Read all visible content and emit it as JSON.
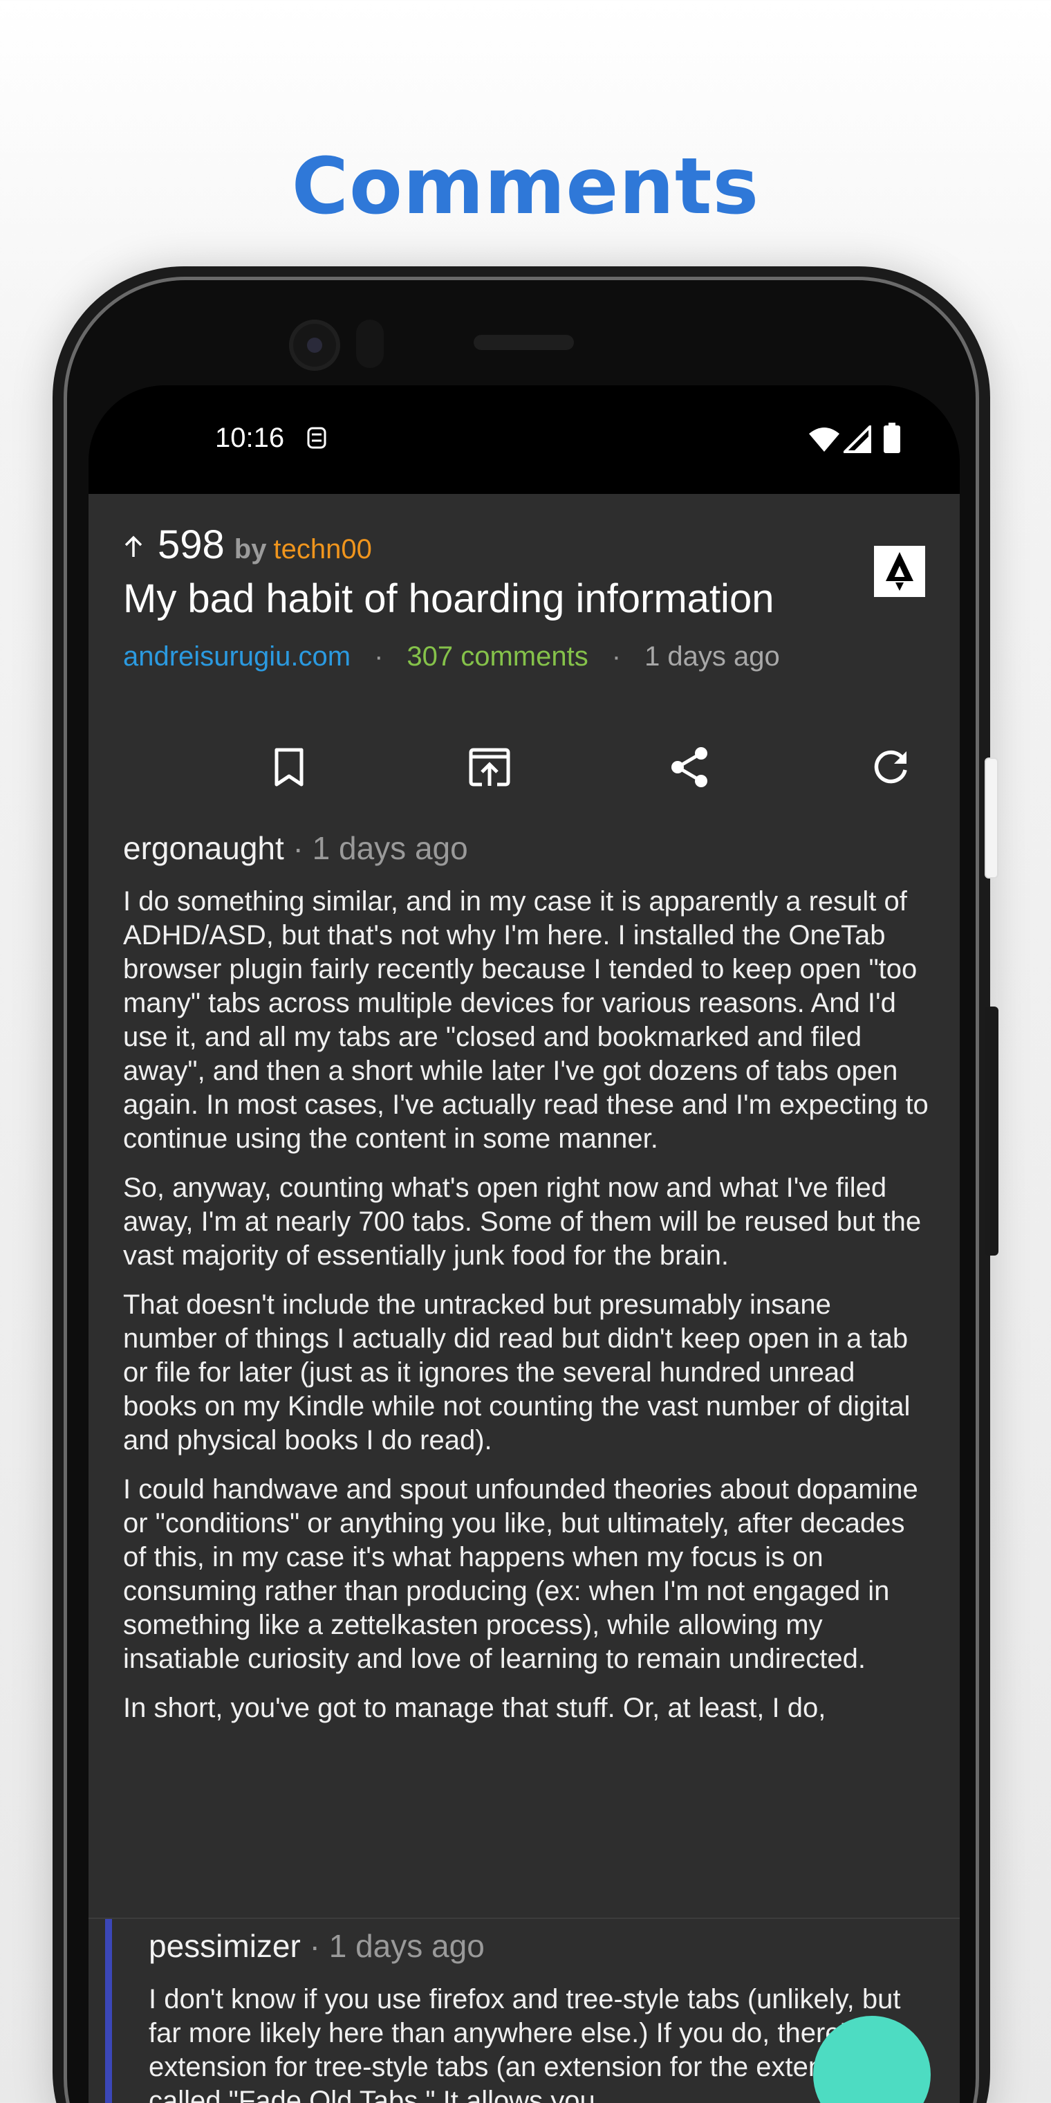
{
  "headline": "Comments",
  "status_bar": {
    "time": "10:16"
  },
  "post": {
    "score": "598",
    "by_label": "by",
    "author": "techn00",
    "title": "My bad habit of hoarding information",
    "domain": "andreisurugiu.com",
    "comments_count": "307 comments",
    "age": "1 days ago",
    "dot": "·"
  },
  "toolbar": {
    "icons": [
      "bookmark-icon",
      "open-external-icon",
      "share-icon",
      "refresh-icon"
    ]
  },
  "comments": [
    {
      "user": "ergonaught",
      "sep": "·",
      "age": "1 days ago",
      "paragraphs": [
        "I do something similar, and in my case it is apparently a result of ADHD/ASD, but that's not why I'm here. I installed the OneTab browser plugin fairly recently because I tended to keep open \"too many\" tabs across multiple devices for various reasons. And I'd use it, and all my tabs are \"closed and bookmarked and filed away\", and then a short while later I've got dozens of tabs open again. In most cases, I've actually read these and I'm expecting to continue using the content in some manner.",
        "So, anyway, counting what's open right now and what I've filed away, I'm at nearly 700 tabs. Some of them will be reused but the vast majority of essentially junk food for the brain.",
        "That doesn't include the untracked but presumably insane number of things I actually did read but didn't keep open in a tab or file for later (just as it ignores the several hundred unread books on my Kindle while not counting the vast number of digital and physical books I do read).",
        "I could handwave and spout unfounded theories about dopamine or \"conditions\" or anything you like, but ultimately, after decades of this, in my case it's what happens when my focus is on consuming rather than producing (ex: when I'm not engaged in something like a zettelkasten process), while allowing my insatiable curiosity and love of learning to remain undirected.",
        "In short, you've got to manage that stuff. Or, at least, I do,"
      ]
    },
    {
      "user": "pessimizer",
      "sep": "·",
      "age": "1 days ago",
      "paragraphs": [
        "I don't know if you use firefox and tree-style tabs (unlikely, but far more likely here than anywhere else.) If you do, there's an extension for tree-style tabs (an extension for the extension) called \"Fade Old Tabs.\" It allows you"
      ]
    }
  ],
  "colors": {
    "headline": "#2f78d8",
    "author": "#f0951d",
    "domain": "#2b9ae0",
    "comments_count": "#85c24a",
    "background": "#2e2e2e",
    "fab": "#4ddcc2",
    "child_rail": "#3b47b8"
  }
}
